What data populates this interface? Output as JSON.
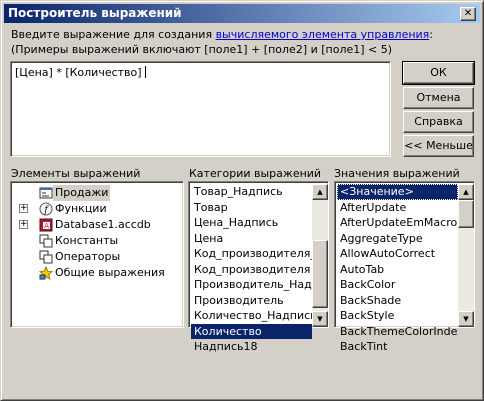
{
  "window": {
    "title": "Построитель выражений",
    "close_glyph": "✕"
  },
  "instructions": {
    "line1_prefix": "Введите выражение для создания ",
    "line1_link": "вычисляемого элемента управления",
    "line1_suffix": ":",
    "line2": "(Примеры выражений включают [поле1] + [поле2] и [поле1] < 5)"
  },
  "expression": {
    "value": "[Цена] * [Количество]"
  },
  "buttons": {
    "ok": "ОК",
    "cancel": "Отмена",
    "help": "Справка",
    "less": "<< Меньше"
  },
  "panels": {
    "elements_label": "Элементы выражений",
    "categories_label": "Категории выражений",
    "values_label": "Значения выражений"
  },
  "elements_tree": [
    {
      "label": "Продажи",
      "icon": "form-icon",
      "expander": "",
      "selected": true
    },
    {
      "label": "Функции",
      "icon": "function-icon",
      "expander": "+",
      "selected": false
    },
    {
      "label": "Database1.accdb",
      "icon": "database-icon",
      "expander": "+",
      "selected": false
    },
    {
      "label": "Константы",
      "icon": "constants-icon",
      "expander": "",
      "selected": false
    },
    {
      "label": "Операторы",
      "icon": "operators-icon",
      "expander": "",
      "selected": false
    },
    {
      "label": "Общие выражения",
      "icon": "common-expressions-icon",
      "expander": "",
      "selected": false
    }
  ],
  "categories": [
    "Товар_Надпись",
    "Товар",
    "Цена_Надпись",
    "Цена",
    "Код_производителя_Надпись",
    "Код_производителя",
    "Производитель_Надпись",
    "Производитель",
    "Количество_Надпись",
    "Количество",
    "Надпись18"
  ],
  "categories_selected": 9,
  "values": [
    "<Значение>",
    "AfterUpdate",
    "AfterUpdateEmMacro",
    "AggregateType",
    "AllowAutoCorrect",
    "AutoTab",
    "BackColor",
    "BackShade",
    "BackStyle",
    "BackThemeColorIndex",
    "BackTint"
  ],
  "values_selected": 0,
  "colors": {
    "selection": "#0a246a",
    "title_start": "#0a246a",
    "title_end": "#a6caf0",
    "link": "#0000cc"
  }
}
